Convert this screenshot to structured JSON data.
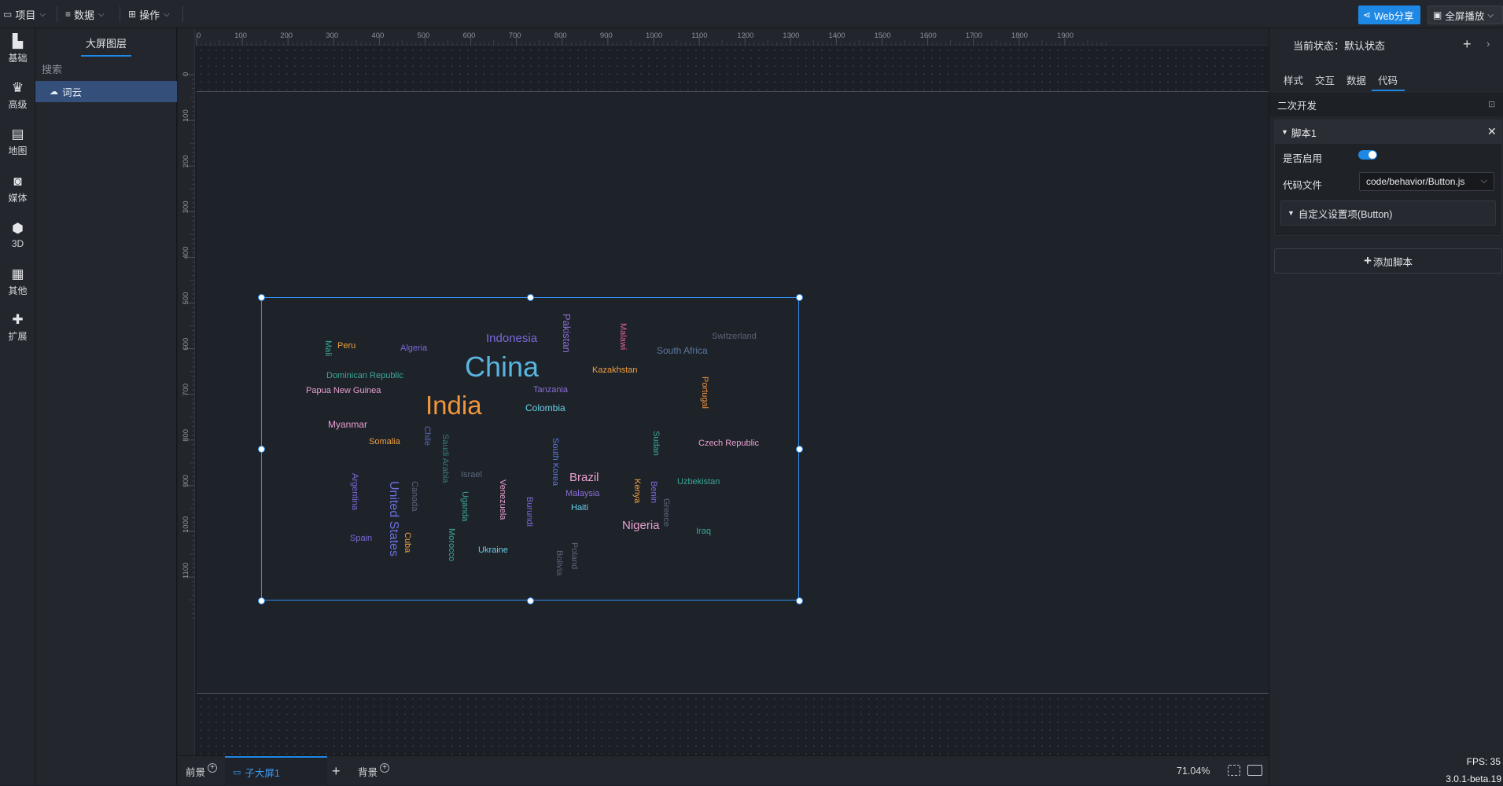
{
  "topbar": {
    "menus": [
      {
        "label": "项目",
        "icon": "folder-icon"
      },
      {
        "label": "数据",
        "icon": "database-icon"
      },
      {
        "label": "操作",
        "icon": "grid-icon"
      }
    ],
    "web_share_label": "Web分享",
    "fullscreen_label": "全屏播放",
    "accent_color": "#1e88e5"
  },
  "rail": {
    "items": [
      {
        "label": "基础",
        "icon": "bar-chart-icon"
      },
      {
        "label": "高级",
        "icon": "crown-icon"
      },
      {
        "label": "地图",
        "icon": "map-icon"
      },
      {
        "label": "媒体",
        "icon": "media-icon"
      },
      {
        "label": "3D",
        "icon": "cube-icon"
      },
      {
        "label": "其他",
        "icon": "layers-icon"
      },
      {
        "label": "扩展",
        "icon": "puzzle-icon"
      }
    ]
  },
  "layers": {
    "title": "大屏图层",
    "search_placeholder": "搜索",
    "items": [
      {
        "label": "词云",
        "icon": "wordcloud-icon"
      }
    ]
  },
  "rulers": {
    "top_ticks": [
      "0",
      "100",
      "200",
      "300",
      "400",
      "500",
      "600",
      "700",
      "800",
      "900",
      "1000",
      "1100",
      "1200",
      "1300",
      "1400",
      "1500",
      "1600",
      "1700",
      "1800",
      "1900"
    ],
    "left_ticks": [
      "0",
      "100",
      "200",
      "300",
      "400",
      "500",
      "600",
      "700",
      "800",
      "900",
      "1000",
      "1100"
    ]
  },
  "wordcloud": {
    "words": [
      {
        "text": "China",
        "color": "#5ab4e0",
        "size": 36,
        "vertical": false
      },
      {
        "text": "India",
        "color": "#f0963c",
        "size": 33,
        "vertical": false
      },
      {
        "text": "Indonesia",
        "color": "#7b6bdc",
        "size": 15,
        "vertical": false
      },
      {
        "text": "Pakistan",
        "color": "#8a6fd6",
        "size": 13,
        "vertical": true
      },
      {
        "text": "Malawi",
        "color": "#e0609a",
        "size": 11,
        "vertical": true
      },
      {
        "text": "Switzerland",
        "color": "#5a6478",
        "size": 11,
        "vertical": false
      },
      {
        "text": "South Africa",
        "color": "#5a7aa0",
        "size": 12,
        "vertical": false
      },
      {
        "text": "Mali",
        "color": "#3aa89a",
        "size": 11,
        "vertical": true
      },
      {
        "text": "Peru",
        "color": "#f0a040",
        "size": 11,
        "vertical": false
      },
      {
        "text": "Algeria",
        "color": "#7b6bdc",
        "size": 11,
        "vertical": false
      },
      {
        "text": "Kazakhstan",
        "color": "#f0a040",
        "size": 11,
        "vertical": false
      },
      {
        "text": "Dominican Republic",
        "color": "#3aa89a",
        "size": 11,
        "vertical": false
      },
      {
        "text": "Portugal",
        "color": "#f0963c",
        "size": 11,
        "vertical": true
      },
      {
        "text": "Papua New Guinea",
        "color": "#e8a0d0",
        "size": 11,
        "vertical": false
      },
      {
        "text": "Tanzania",
        "color": "#8a6fd6",
        "size": 11,
        "vertical": false
      },
      {
        "text": "Colombia",
        "color": "#6ad0e8",
        "size": 12,
        "vertical": false
      },
      {
        "text": "Myanmar",
        "color": "#e8a0d0",
        "size": 12,
        "vertical": false
      },
      {
        "text": "Chile",
        "color": "#5a6aa8",
        "size": 11,
        "vertical": true
      },
      {
        "text": "Saudi Arabia",
        "color": "#3a7a78",
        "size": 11,
        "vertical": true
      },
      {
        "text": "Sudan",
        "color": "#3aa89a",
        "size": 11,
        "vertical": true
      },
      {
        "text": "Somalia",
        "color": "#f0a040",
        "size": 11,
        "vertical": false
      },
      {
        "text": "Czech Republic",
        "color": "#e8a0d0",
        "size": 11,
        "vertical": false
      },
      {
        "text": "South Korea",
        "color": "#5a78d8",
        "size": 11,
        "vertical": true
      },
      {
        "text": "Israel",
        "color": "#5a6a80",
        "size": 11,
        "vertical": false
      },
      {
        "text": "Brazil",
        "color": "#e8a0d0",
        "size": 15,
        "vertical": false
      },
      {
        "text": "Argentina",
        "color": "#7b6bdc",
        "size": 11,
        "vertical": true
      },
      {
        "text": "United States",
        "color": "#6a70e0",
        "size": 16,
        "vertical": true
      },
      {
        "text": "Canada",
        "color": "#5a6478",
        "size": 11,
        "vertical": true
      },
      {
        "text": "Uganda",
        "color": "#3aa89a",
        "size": 11,
        "vertical": true
      },
      {
        "text": "Venezuela",
        "color": "#e8a0d0",
        "size": 11,
        "vertical": true
      },
      {
        "text": "Burundi",
        "color": "#7b6bdc",
        "size": 11,
        "vertical": true
      },
      {
        "text": "Kenya",
        "color": "#f0a040",
        "size": 11,
        "vertical": true
      },
      {
        "text": "Benin",
        "color": "#7b6bdc",
        "size": 11,
        "vertical": true
      },
      {
        "text": "Uzbekistan",
        "color": "#3aa89a",
        "size": 11,
        "vertical": false
      },
      {
        "text": "Malaysia",
        "color": "#8a6fd6",
        "size": 11,
        "vertical": false
      },
      {
        "text": "Greece",
        "color": "#5a6478",
        "size": 11,
        "vertical": true
      },
      {
        "text": "Haiti",
        "color": "#6ad0e8",
        "size": 11,
        "vertical": false
      },
      {
        "text": "Nigeria",
        "color": "#e8a0d0",
        "size": 15,
        "vertical": false
      },
      {
        "text": "Iraq",
        "color": "#3aa89a",
        "size": 11,
        "vertical": false
      },
      {
        "text": "Spain",
        "color": "#7b6bdc",
        "size": 11,
        "vertical": false
      },
      {
        "text": "Cuba",
        "color": "#f0a040",
        "size": 11,
        "vertical": true
      },
      {
        "text": "Morocco",
        "color": "#3aa89a",
        "size": 11,
        "vertical": true
      },
      {
        "text": "Ukraine",
        "color": "#6ad0e8",
        "size": 11,
        "vertical": false
      },
      {
        "text": "Poland",
        "color": "#5a6478",
        "size": 11,
        "vertical": true
      },
      {
        "text": "Bolivia",
        "color": "#5a6478",
        "size": 11,
        "vertical": true
      }
    ]
  },
  "bottombar": {
    "foreground_label": "前景",
    "subscreen_label": "子大屏1",
    "background_label": "背景",
    "zoom_level": "71.04%"
  },
  "props": {
    "current_state_label": "当前状态：默认状态",
    "tabs": [
      {
        "label": "样式",
        "active": false
      },
      {
        "label": "交互",
        "active": false
      },
      {
        "label": "数据",
        "active": false
      },
      {
        "label": "代码",
        "active": true
      }
    ],
    "dev_header": "二次开发",
    "script_title": "脚本1",
    "enabled_label": "是否启用",
    "enabled": true,
    "code_file_label": "代码文件",
    "code_file_value": "code/behavior/Button.js",
    "custom_settings_label": "自定义设置项(Button)",
    "add_script_label": "添加脚本"
  },
  "status": {
    "fps": "FPS: 35",
    "version": "3.0.1-beta.19"
  }
}
